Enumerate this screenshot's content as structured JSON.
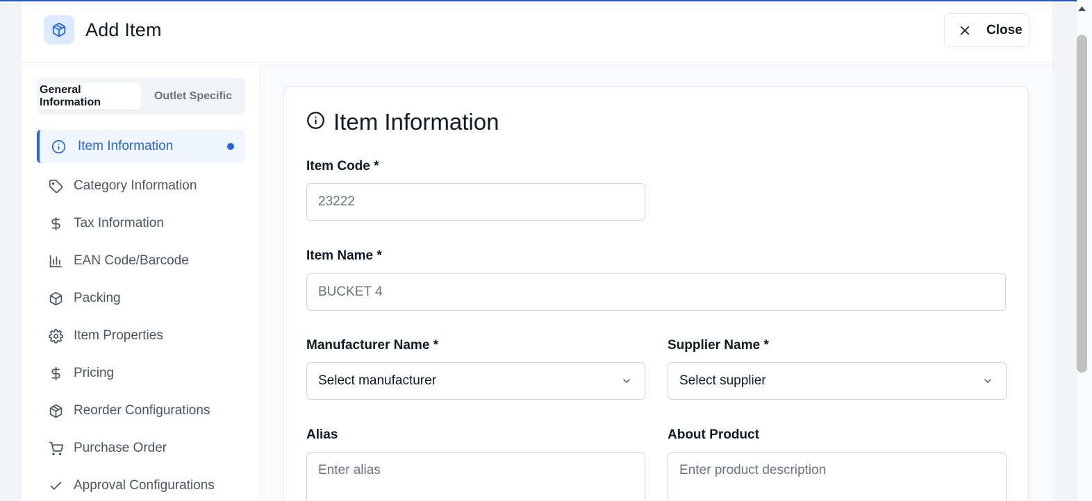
{
  "header": {
    "title": "Add Item",
    "close_label": "Close",
    "icon": "package-icon"
  },
  "sidebar": {
    "tabs": [
      {
        "label": "General Information",
        "active": true
      },
      {
        "label": "Outlet Specific",
        "active": false
      }
    ],
    "items": [
      {
        "label": "Item Information",
        "icon": "info-icon",
        "active": true
      },
      {
        "label": "Category Information",
        "icon": "tag-icon"
      },
      {
        "label": "Tax Information",
        "icon": "dollar-icon"
      },
      {
        "label": "EAN Code/Barcode",
        "icon": "bar-chart-icon"
      },
      {
        "label": "Packing",
        "icon": "box-icon"
      },
      {
        "label": "Item Properties",
        "icon": "gear-icon"
      },
      {
        "label": "Pricing",
        "icon": "dollar-icon"
      },
      {
        "label": "Reorder Configurations",
        "icon": "box-icon"
      },
      {
        "label": "Purchase Order",
        "icon": "cart-icon"
      },
      {
        "label": "Approval Configurations",
        "icon": "check-icon"
      }
    ]
  },
  "form": {
    "section_title": "Item Information",
    "item_code": {
      "label": "Item Code *",
      "placeholder": "23222"
    },
    "item_name": {
      "label": "Item Name *",
      "placeholder": "BUCKET 4"
    },
    "manufacturer": {
      "label": "Manufacturer Name *",
      "value": "Select manufacturer"
    },
    "supplier": {
      "label": "Supplier Name *",
      "value": "Select supplier"
    },
    "alias": {
      "label": "Alias",
      "placeholder": "Enter alias"
    },
    "about": {
      "label": "About Product",
      "placeholder": "Enter product description"
    }
  },
  "colors": {
    "accent": "#2563eb",
    "accent_bg": "#eff6ff",
    "text": "#111827",
    "muted": "#6b7280"
  }
}
